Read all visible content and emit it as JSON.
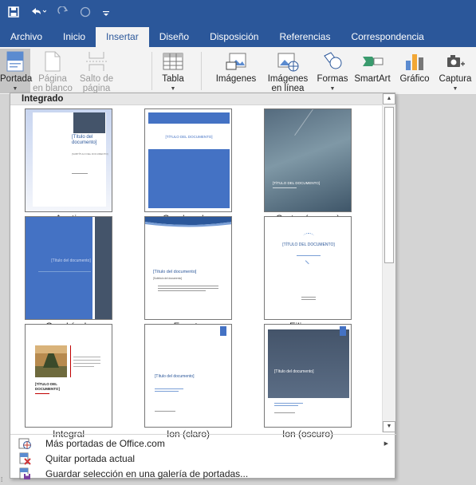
{
  "qat": {
    "save": "save-icon",
    "undo": "undo-icon",
    "redo": "redo-icon",
    "touch": "touch-mode-icon",
    "customize": "customize-icon"
  },
  "tabs": [
    {
      "label": "Archivo"
    },
    {
      "label": "Inicio"
    },
    {
      "label": "Insertar",
      "active": true
    },
    {
      "label": "Diseño"
    },
    {
      "label": "Disposición"
    },
    {
      "label": "Referencias"
    },
    {
      "label": "Correspondencia"
    }
  ],
  "ribbon": {
    "portada": "Portada",
    "pagina_en_blanco_1": "Página",
    "pagina_en_blanco_2": "en blanco",
    "salto_de_pagina_1": "Salto de",
    "salto_de_pagina_2": "página",
    "tabla": "Tabla",
    "imagenes": "Imágenes",
    "imagenes_en_linea_1": "Imágenes",
    "imagenes_en_linea_2": "en línea",
    "formas": "Formas",
    "smartart": "SmartArt",
    "grafico": "Gráfico",
    "captura": "Captura"
  },
  "gallery": {
    "header": "Integrado",
    "items": [
      {
        "label": "Austin",
        "title": "[Título del documento]",
        "sub": "[SUBTÍTULO DEL DOCUMENTO]"
      },
      {
        "label": "Con bandas",
        "title": "[TÍTULO DEL DOCUMENTO]"
      },
      {
        "label": "Cortar (oscuro)",
        "title": "[TÍTULO DEL DOCUMENTO]"
      },
      {
        "label": "Cuadrícula",
        "title": "[Título del documento]"
      },
      {
        "label": "Faceta",
        "title": "[Título del documento]",
        "sub": "[Subtítulo del documento]"
      },
      {
        "label": "Filigrana",
        "title": "[TÍTULO DEL DOCUMENTO]"
      },
      {
        "label": "Integral",
        "title": "[TÍTULO DEL DOCUMENTO]"
      },
      {
        "label": "Ion (claro)",
        "title": "[Título del documento]"
      },
      {
        "label": "Ion (oscuro)",
        "title": "[Título del documento]"
      }
    ]
  },
  "menu": {
    "more": "Más portadas de Office.com",
    "remove": "Quitar portada actual",
    "save": "Guardar selección en una galería de portadas..."
  },
  "colors": {
    "brand": "#2b579a",
    "blue": "#4472c4",
    "slate": "#44546a"
  }
}
